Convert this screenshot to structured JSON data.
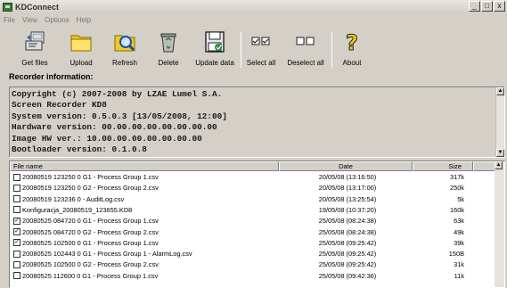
{
  "window": {
    "title": "KDConnect",
    "min": "_",
    "max": "□",
    "close": "x"
  },
  "menu": [
    "File",
    "View",
    "Options",
    "Help"
  ],
  "toolbar": {
    "buttons": [
      {
        "label": "Get files",
        "icon": "get-files-icon"
      },
      {
        "label": "Upload",
        "icon": "folder-icon"
      },
      {
        "label": "Refresh",
        "icon": "magnifier-icon"
      },
      {
        "label": "Delete",
        "icon": "recycle-bin-icon"
      },
      {
        "label": "Update data",
        "icon": "floppy-update-icon"
      },
      {
        "label": "Select all",
        "icon": "checkbox-checked-icon"
      },
      {
        "label": "Deselect all",
        "icon": "checkbox-empty-icon"
      },
      {
        "label": "About",
        "icon": "question-mark-icon"
      }
    ]
  },
  "recorder": {
    "label": "Recorder information:",
    "lines": [
      "Copyright (c) 2007-2008 by LZAE Lumel S.A.",
      "Screen Recorder KD8",
      "System version: 0.5.0.3 [13/05/2008, 12:00]",
      "Hardware version: 00.00.00.00.00.00.00.00",
      "Image HW ver.: 10.00.00.00.00.00.00.00",
      "Bootloader version: 0.1.0.8"
    ]
  },
  "file_list": {
    "columns": {
      "name": "File name",
      "date": "Date",
      "size": "Size"
    },
    "rows": [
      {
        "checked": false,
        "name": "20080519 123250 0 G1 - Process Group 1.csv",
        "date": "20/05/08 (13:16:50)",
        "size": "317k"
      },
      {
        "checked": false,
        "name": "20080519 123250 0 G2 - Process Group 2.csv",
        "date": "20/05/08 (13:17:00)",
        "size": "250k"
      },
      {
        "checked": false,
        "name": "20080519 123236 0 - AuditLog.csv",
        "date": "20/05/08 (13:25:54)",
        "size": "5k"
      },
      {
        "checked": false,
        "name": "Konfiguracja_20080519_123655.KD8",
        "date": "19/05/08 (10:37:20)",
        "size": "160k"
      },
      {
        "checked": true,
        "name": "20080525 084720 0 G1 - Process Group 1.csv",
        "date": "25/05/08 (08:24:38)",
        "size": "63k"
      },
      {
        "checked": true,
        "name": "20080525 084720 0 G2 - Process Group 2.csv",
        "date": "25/05/08 (08:24:38)",
        "size": "49k"
      },
      {
        "checked": true,
        "name": "20080525 102500 0 G1 - Process Group 1.csv",
        "date": "25/05/08 (09:25:42)",
        "size": "39k"
      },
      {
        "checked": false,
        "name": "20080525 102443 0 G1 - Process Group 1 - AlarmLog.csv",
        "date": "25/05/08 (09:25:42)",
        "size": "150B"
      },
      {
        "checked": false,
        "name": "20080525 102500 0 G2 - Process Group 2.csv",
        "date": "25/05/08 (09:25:42)",
        "size": "31k"
      },
      {
        "checked": false,
        "name": "20080525 112600 0 G1 - Process Group 1.csv",
        "date": "25/05/08 (09:42:36)",
        "size": "11k"
      }
    ]
  }
}
